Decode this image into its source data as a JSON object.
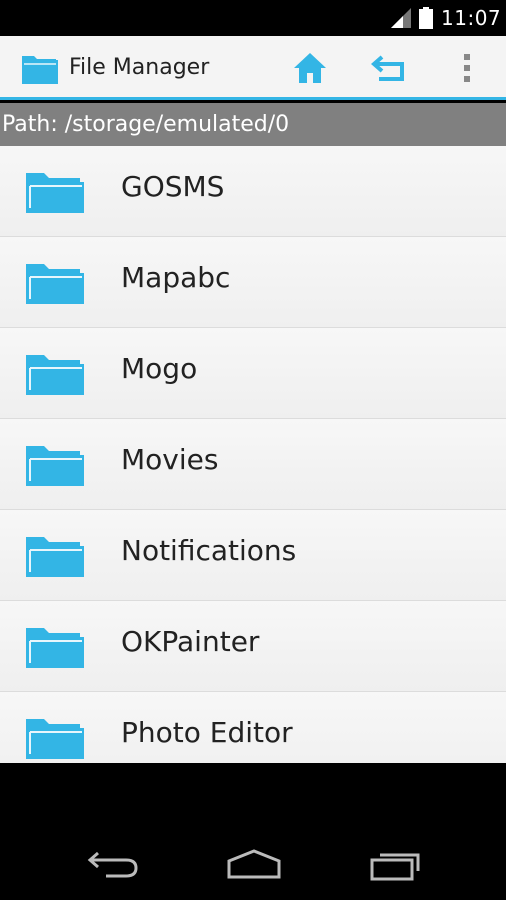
{
  "status_bar": {
    "time": "11:07",
    "signal_icon": "cell-signal-icon",
    "battery_icon": "battery-icon"
  },
  "action_bar": {
    "title": "File Manager",
    "app_icon": "folder-icon",
    "home_icon": "home-icon",
    "back_icon": "back-arrow-icon",
    "overflow_icon": "overflow-menu-icon"
  },
  "path_bar": {
    "text": "Path: /storage/emulated/0"
  },
  "files": [
    {
      "name": "GOSMS"
    },
    {
      "name": "Mapabc"
    },
    {
      "name": "Mogo"
    },
    {
      "name": "Movies"
    },
    {
      "name": "Notifications"
    },
    {
      "name": "OKPainter"
    },
    {
      "name": "Photo Editor"
    }
  ],
  "nav_bar": {
    "back_icon": "nav-back-icon",
    "home_icon": "nav-home-icon",
    "recent_icon": "nav-recent-apps-icon"
  },
  "colors": {
    "accent": "#33b5e5",
    "folder": "#33b5e5",
    "path_bar_bg": "#808080"
  }
}
